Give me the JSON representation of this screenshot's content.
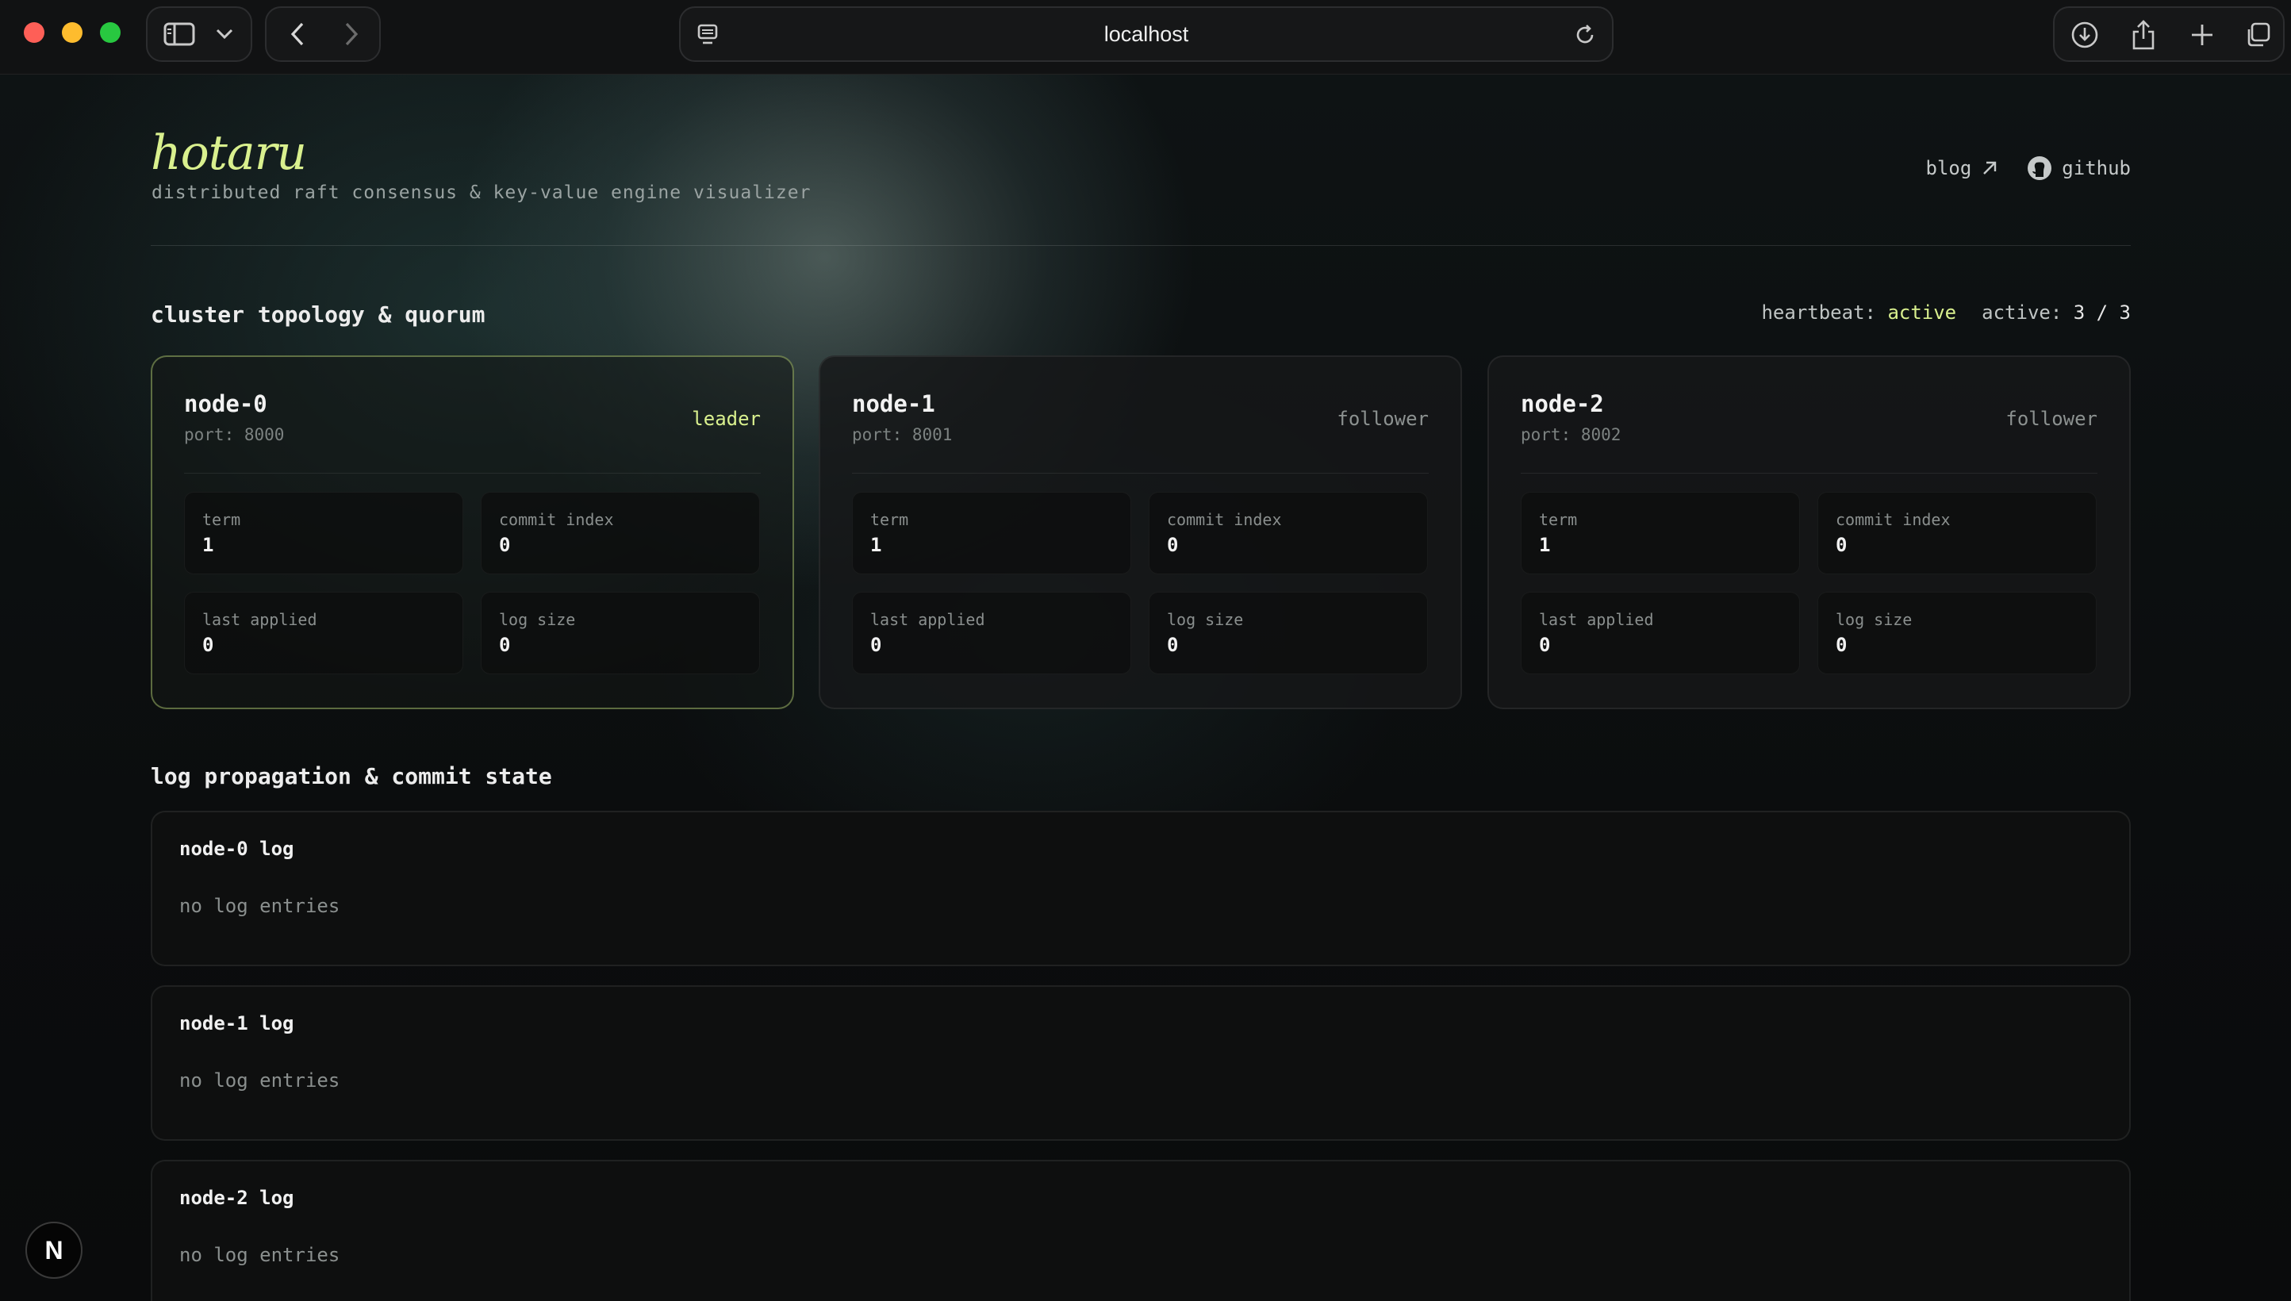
{
  "browser": {
    "url": "localhost"
  },
  "header": {
    "brand": "hotaru",
    "tagline": "distributed raft consensus & key-value engine visualizer",
    "links": [
      {
        "label": "blog",
        "icon": "arrow-up-right-icon"
      },
      {
        "label": "github",
        "icon": "github-icon"
      }
    ]
  },
  "cluster": {
    "title": "cluster topology & quorum",
    "heartbeat_label": "heartbeat:",
    "heartbeat_value": "active",
    "active_label": "active:",
    "active_value": "3 / 3",
    "stat_labels": {
      "term": "term",
      "commit": "commit index",
      "applied": "last applied",
      "logsize": "log size"
    },
    "nodes": [
      {
        "name": "node-0",
        "port": "port: 8000",
        "role": "leader",
        "term": "1",
        "commit": "0",
        "applied": "0",
        "logsize": "0"
      },
      {
        "name": "node-1",
        "port": "port: 8001",
        "role": "follower",
        "term": "1",
        "commit": "0",
        "applied": "0",
        "logsize": "0"
      },
      {
        "name": "node-2",
        "port": "port: 8002",
        "role": "follower",
        "term": "1",
        "commit": "0",
        "applied": "0",
        "logsize": "0"
      }
    ]
  },
  "logs": {
    "title": "log propagation & commit state",
    "items": [
      {
        "title": "node-0 log",
        "empty": "no log entries"
      },
      {
        "title": "node-1 log",
        "empty": "no log entries"
      },
      {
        "title": "node-2 log",
        "empty": "no log entries"
      }
    ]
  },
  "devtools": {
    "badge": "N"
  },
  "colors": {
    "accent": "#d9f08e",
    "leader_border": "#bbd778"
  }
}
